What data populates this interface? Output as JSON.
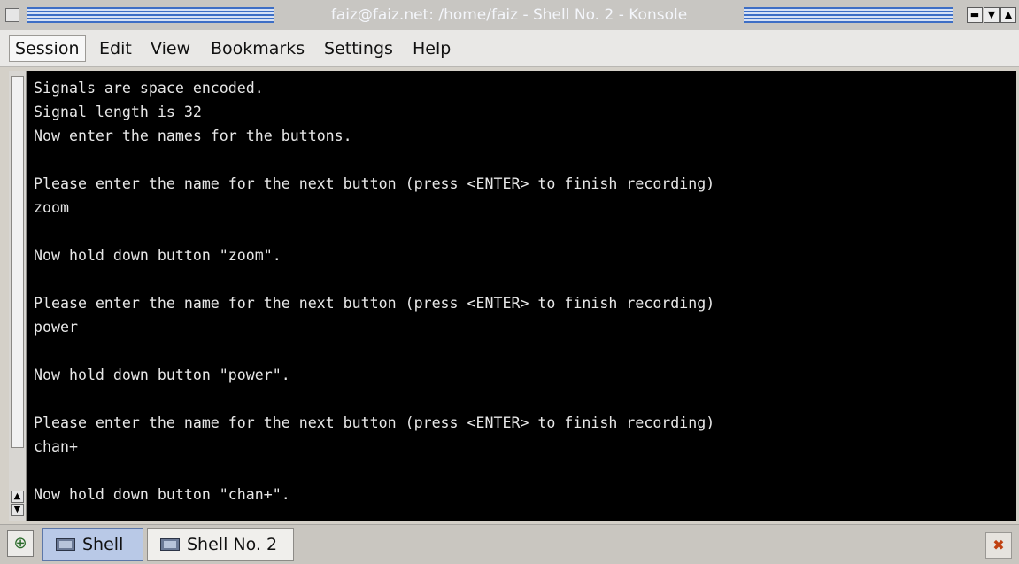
{
  "window": {
    "title": "faiz@faiz.net: /home/faiz - Shell No. 2 - Konsole",
    "controls": {
      "minimize": "▬",
      "maximize": "▼",
      "close": "▲"
    }
  },
  "menu": {
    "items": [
      {
        "label": "Session"
      },
      {
        "label": "Edit"
      },
      {
        "label": "View"
      },
      {
        "label": "Bookmarks"
      },
      {
        "label": "Settings"
      },
      {
        "label": "Help"
      }
    ]
  },
  "terminal": {
    "lines": [
      "Signals are space encoded.",
      "Signal length is 32",
      "Now enter the names for the buttons.",
      "",
      "Please enter the name for the next button (press <ENTER> to finish recording)",
      "zoom",
      "",
      "Now hold down button \"zoom\".",
      "",
      "Please enter the name for the next button (press <ENTER> to finish recording)",
      "power",
      "",
      "Now hold down button \"power\".",
      "",
      "Please enter the name for the next button (press <ENTER> to finish recording)",
      "chan+",
      "",
      "Now hold down button \"chan+\"."
    ]
  },
  "tabs": [
    {
      "label": "Shell",
      "selected": true
    },
    {
      "label": "Shell No. 2",
      "selected": false
    }
  ],
  "icons": {
    "new_tab": "new-session-icon",
    "close_tab": "close-session-icon",
    "tab": "terminal-icon"
  },
  "colors": {
    "terminal_bg": "#000000",
    "terminal_fg": "#e7e7e7",
    "title_accent": "#3d6ec5",
    "selected_tab": "#b9c9e7"
  }
}
